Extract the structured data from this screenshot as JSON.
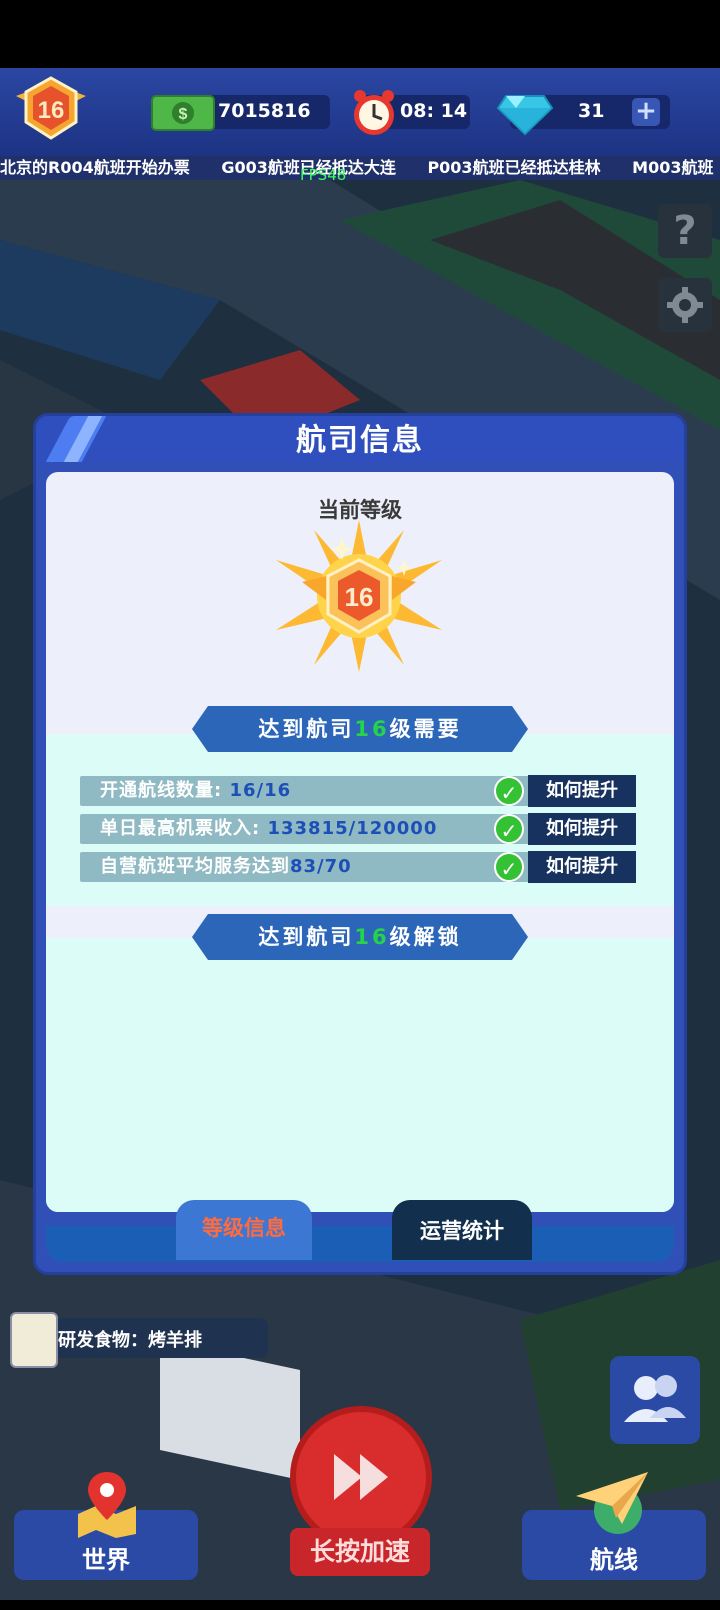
{
  "hud": {
    "level": "16",
    "money": "7015816",
    "time": "08: 14",
    "diamonds": "31",
    "plus": "+"
  },
  "ticker": [
    "北京的R004航班开始办票",
    "G003航班已经抵达大连",
    "P003航班已经抵达桂林",
    "M003航班"
  ],
  "fps": "FPS48",
  "side": {
    "help": "?"
  },
  "dialog": {
    "title": "航司信息",
    "current_level_label": "当前等级",
    "level_value": "16",
    "req_ribbon": {
      "pre": "达到航司",
      "num": "16",
      "post": "级需要"
    },
    "requirements": [
      {
        "label": "开通航线数量:",
        "value": "16/16",
        "done": true,
        "button": "如何提升"
      },
      {
        "label": "单日最高机票收入:",
        "value": "133815/120000",
        "done": true,
        "button": "如何提升"
      },
      {
        "label": "自营航班平均服务达到",
        "value": "83/70",
        "done": true,
        "button": "如何提升"
      }
    ],
    "unlock_ribbon": {
      "pre": "达到航司",
      "num": "16",
      "post": "级解锁"
    },
    "tabs": {
      "active": "等级信息",
      "other": "运营统计"
    }
  },
  "bottom": {
    "research": "研发食物：烤羊排",
    "world": "世界",
    "speed": "长按加速",
    "routes": "航线"
  },
  "colors": {
    "accent": "#2c66b8",
    "tab_active_text": "#ff6b3d",
    "done_green": "#34c234"
  }
}
